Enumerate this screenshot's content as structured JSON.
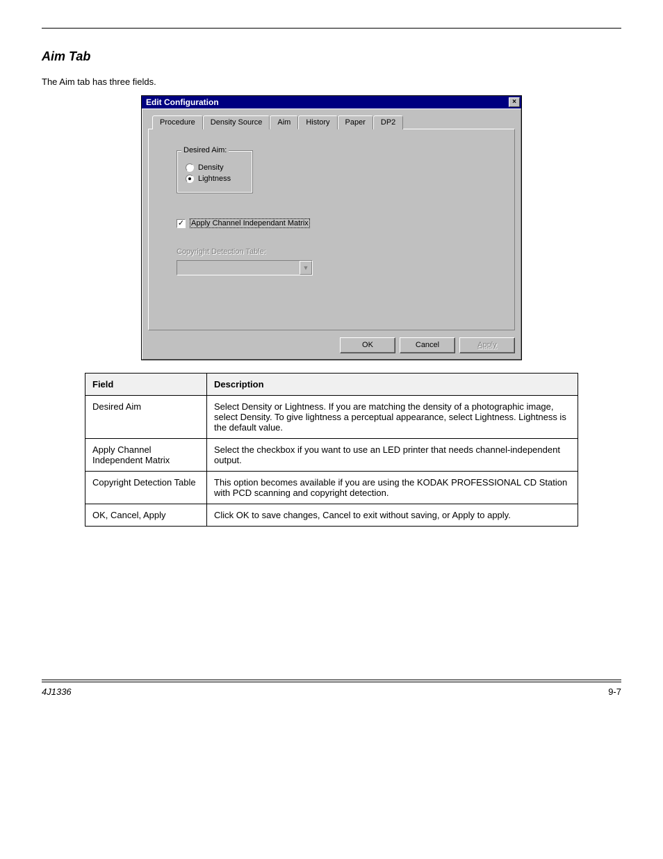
{
  "header": {},
  "section": {
    "heading": "Aim Tab",
    "intro_text": "The Aim tab has three fields."
  },
  "dialog": {
    "title": "Edit Configuration",
    "close_label": "×",
    "tabs": [
      "Procedure",
      "Density Source",
      "Aim",
      "History",
      "Paper",
      "DP2"
    ],
    "active_tab_index": 2,
    "groupbox_title": "Desired Aim:",
    "radio_density": "Density",
    "radio_lightness": "Lightness",
    "selected_radio": "lightness",
    "checkbox_checked": true,
    "checkbox_label": "Apply Channel Independant Matrix",
    "disabled_label": "Copyright Detection Table:",
    "combo_value": "",
    "buttons": {
      "ok": "OK",
      "cancel": "Cancel",
      "apply": "Apply"
    }
  },
  "table": {
    "headers": [
      "Field",
      "Description"
    ],
    "rows": [
      {
        "field": "Desired Aim",
        "desc": "Select Density or Lightness. If you are matching the density of a photographic image, select Density. To give lightness a perceptual appearance, select Lightness. Lightness is the default value."
      },
      {
        "field": "Apply Channel Independent Matrix",
        "desc": "Select the checkbox if you want to use an LED printer that needs channel-independent output."
      },
      {
        "field": "Copyright Detection Table",
        "desc": "This option becomes available if you are using the KODAK PROFESSIONAL CD Station with PCD scanning and copyright detection."
      },
      {
        "field": "OK, Cancel, Apply",
        "desc": "Click OK to save changes, Cancel to exit without saving, or Apply to apply."
      }
    ]
  },
  "footer": {
    "doc_id": "4J1336",
    "page": "9-7"
  }
}
